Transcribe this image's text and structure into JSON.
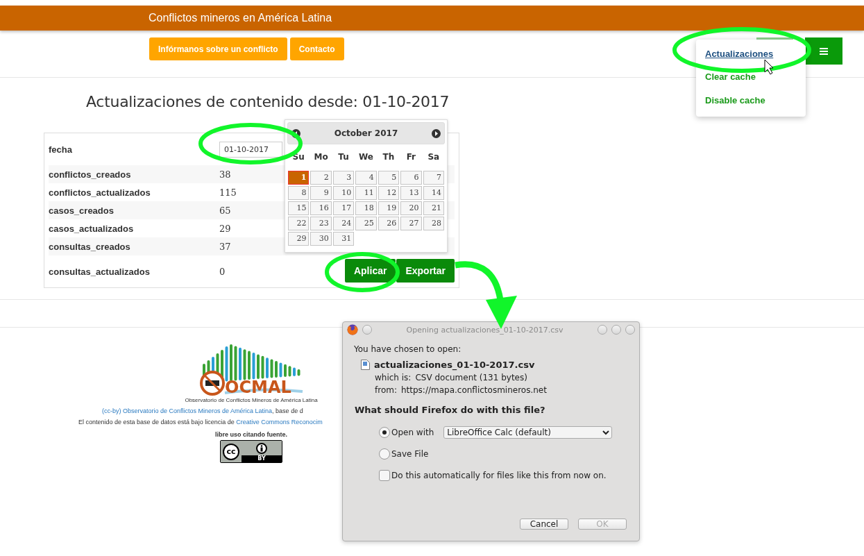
{
  "header": {
    "title": "Conflictos mineros en América Latina"
  },
  "nav_buttons": [
    "Infórmanos sobre un conflicto",
    "Contacto"
  ],
  "settings_menu": {
    "items": [
      {
        "label": "Actualizaciones",
        "selected": true
      },
      {
        "label": "Clear cache",
        "selected": false
      },
      {
        "label": "Disable cache",
        "selected": false
      }
    ]
  },
  "page_title": "Actualizaciones de contenido desde: 01-10-2017",
  "date_field": {
    "label": "fecha",
    "value": "01-10-2017"
  },
  "stats": [
    {
      "name": "conflictos_creados",
      "value": "38"
    },
    {
      "name": "conflictos_actualizados",
      "value": "115"
    },
    {
      "name": "casos_creados",
      "value": "65"
    },
    {
      "name": "casos_actualizados",
      "value": "29"
    },
    {
      "name": "consultas_creados",
      "value": "37"
    },
    {
      "name": "consultas_actualizados",
      "value": "0"
    }
  ],
  "actions": [
    "Aplicar",
    "Exportar"
  ],
  "datepicker": {
    "month": "October 2017",
    "weekdays": [
      "Su",
      "Mo",
      "Tu",
      "We",
      "Th",
      "Fr",
      "Sa"
    ],
    "days": [
      {
        "label": "1",
        "selected": true
      },
      {
        "label": "2",
        "selected": false
      },
      {
        "label": "3",
        "selected": false
      },
      {
        "label": "4",
        "selected": false
      },
      {
        "label": "5",
        "selected": false
      },
      {
        "label": "6",
        "selected": false
      },
      {
        "label": "7",
        "selected": false
      },
      {
        "label": "8",
        "selected": false
      },
      {
        "label": "9",
        "selected": false
      },
      {
        "label": "10",
        "selected": false
      },
      {
        "label": "11",
        "selected": false
      },
      {
        "label": "12",
        "selected": false
      },
      {
        "label": "13",
        "selected": false
      },
      {
        "label": "14",
        "selected": false
      },
      {
        "label": "15",
        "selected": false
      },
      {
        "label": "16",
        "selected": false
      },
      {
        "label": "17",
        "selected": false
      },
      {
        "label": "18",
        "selected": false
      },
      {
        "label": "19",
        "selected": false
      },
      {
        "label": "20",
        "selected": false
      },
      {
        "label": "21",
        "selected": false
      },
      {
        "label": "22",
        "selected": false
      },
      {
        "label": "23",
        "selected": false
      },
      {
        "label": "24",
        "selected": false
      },
      {
        "label": "25",
        "selected": false
      },
      {
        "label": "26",
        "selected": false
      },
      {
        "label": "27",
        "selected": false
      },
      {
        "label": "28",
        "selected": false
      },
      {
        "label": "29",
        "selected": false
      },
      {
        "label": "30",
        "selected": false
      },
      {
        "label": "31",
        "selected": false
      }
    ]
  },
  "footer": {
    "logo_text": "OCMAL",
    "logo_caption": "Observatorio de Conflictos Mineros de América Latina",
    "credit_link": "(cc-by) Observatorio de Conflictos Mineros de América Latina",
    "credit_rest": ", base de d",
    "license_text": "El contenido de esta base de datos está bajo licencia de ",
    "license_link": "Creative Commons Reconocim",
    "note": "libre uso citando fuente.",
    "badge": {
      "mark": "cc",
      "label": "BY"
    }
  },
  "dialog": {
    "title": "Opening actualizaciones_01-10-2017.csv",
    "intro": "You have chosen to open:",
    "file_name": "actualizaciones_01-10-2017.csv",
    "info": [
      {
        "label": "which is:",
        "value": "CSV document (131 bytes)"
      },
      {
        "label": "from:",
        "value": "https://mapa.conflictosmineros.net"
      }
    ],
    "question": "What should Firefox do with this file?",
    "options": [
      {
        "label": "Open with",
        "selected": true
      },
      {
        "label": "Save File",
        "selected": false
      }
    ],
    "app_select": "LibreOffice Calc (default)",
    "auto_checkbox": {
      "label": "Do this automatically for files like this from now on.",
      "checked": false
    },
    "buttons": [
      {
        "label": "Cancel",
        "disabled": false
      },
      {
        "label": "OK",
        "disabled": true
      }
    ]
  }
}
